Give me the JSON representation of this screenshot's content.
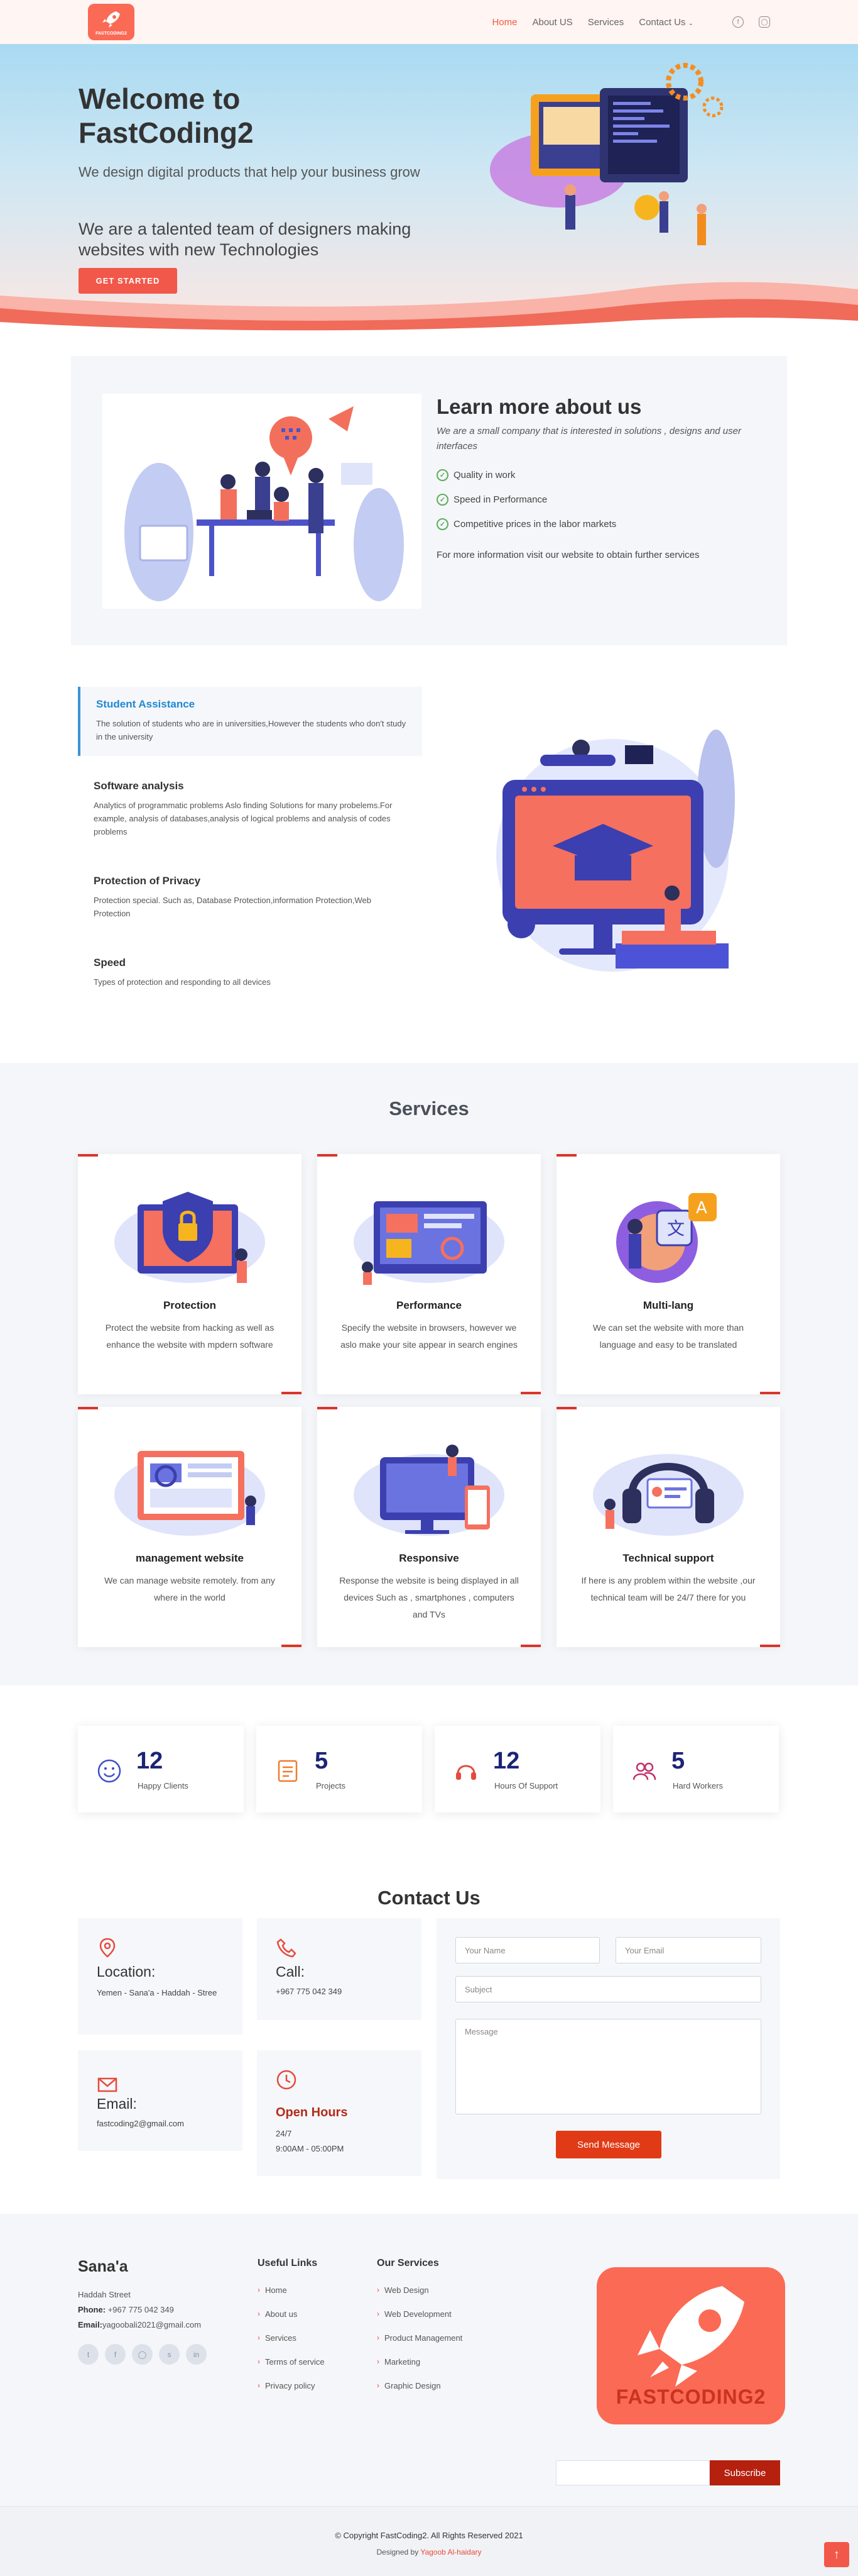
{
  "header": {
    "logo_text": "FASTCODING2",
    "nav": [
      "Home",
      "About US",
      "Services",
      "Contact Us"
    ],
    "social_icons": [
      "facebook-icon",
      "instagram-icon"
    ]
  },
  "hero": {
    "title": "Welcome to FastCoding2",
    "subtitle": "We design digital products that help your business grow",
    "tagline": "We are a talented team of designers making websites with new Technologies",
    "cta": "GET STARTED"
  },
  "about": {
    "title": "Learn more about us",
    "lead": "We are a small company that is interested in solutions , designs and user interfaces",
    "points": [
      "Quality in work",
      "Speed in Performance",
      "Competitive prices in the labor markets"
    ],
    "more": "For more information visit our website to obtain further services"
  },
  "features": [
    {
      "title": "Student Assistance",
      "text": "The solution of students who are in universities,However the students who don't study in the university"
    },
    {
      "title": "Software analysis",
      "text": "Analytics of programmatic problems Aslo finding Solutions for many probelems.For example, analysis of databases,analysis of logical problems and analysis of codes problems"
    },
    {
      "title": "Protection of Privacy",
      "text": "Protection special. Such as, Database Protection,information Protection,Web Protection"
    },
    {
      "title": "Speed",
      "text": "Types of protection and responding to all devices"
    }
  ],
  "services": {
    "title": "Services",
    "items": [
      {
        "title": "Protection",
        "text": "Protect the website from hacking as well as enhance the website with mpdern software"
      },
      {
        "title": "Performance",
        "text": "Specify the website in browsers, however we aslo make your site appear in search engines"
      },
      {
        "title": "Multi-lang",
        "text": "We can set the website with more than language and easy to be translated"
      },
      {
        "title": "management website",
        "text": "We can manage website remotely. from any where in the world"
      },
      {
        "title": "Responsive",
        "text": "Response the website is being displayed in all devices Such as , smartphones , computers and TVs"
      },
      {
        "title": "Technical support",
        "text": "If here is any problem within the website ,our technical team will be 24/7 there for you"
      }
    ]
  },
  "counters": [
    {
      "num": "12",
      "label": "Happy Clients",
      "icon": "smile-icon",
      "color": "#3b4ec8"
    },
    {
      "num": "5",
      "label": "Projects",
      "icon": "list-icon",
      "color": "#f07a2f"
    },
    {
      "num": "12",
      "label": "Hours Of Support",
      "icon": "headphones-icon",
      "color": "#e54b3d"
    },
    {
      "num": "5",
      "label": "Hard Workers",
      "icon": "people-icon",
      "color": "#c2306b"
    }
  ],
  "contact": {
    "title": "Contact Us",
    "location_title": "Location:",
    "location_text": "Yemen - Sana'a - Haddah - Stree",
    "call_title": "Call:",
    "call_text": "+967 775 042 349",
    "email_title": "Email:",
    "email_text": "fastcoding2@gmail.com",
    "hours_title": "Open Hours",
    "hours_line1": "24/7",
    "hours_line2": "9:00AM - 05:00PM",
    "form": {
      "name_ph": "Your Name",
      "email_ph": "Your Email",
      "subject_ph": "Subject",
      "message_ph": "Message",
      "send": "Send Message"
    }
  },
  "footer": {
    "brand": "Sana'a",
    "street": "Haddah Street",
    "phone_label": "Phone:",
    "phone": "+967 775 042 349",
    "email_label": "Email:",
    "email": "yagoobali2021@gmail.com",
    "useful_title": "Useful Links",
    "useful": [
      "Home",
      "About us",
      "Services",
      "Terms of service",
      "Privacy policy"
    ],
    "services_title": "Our Services",
    "services": [
      "Web Design",
      "Web Development",
      "Product Management",
      "Marketing",
      "Graphic Design"
    ],
    "logo_text": "FASTCODING2",
    "subscribe": "Subscribe",
    "copyright": "© Copyright FastCoding2. All Rights Reserved 2021",
    "designed_by_label": "Designed by",
    "designed_by": "Yagoob Al-haidary"
  }
}
